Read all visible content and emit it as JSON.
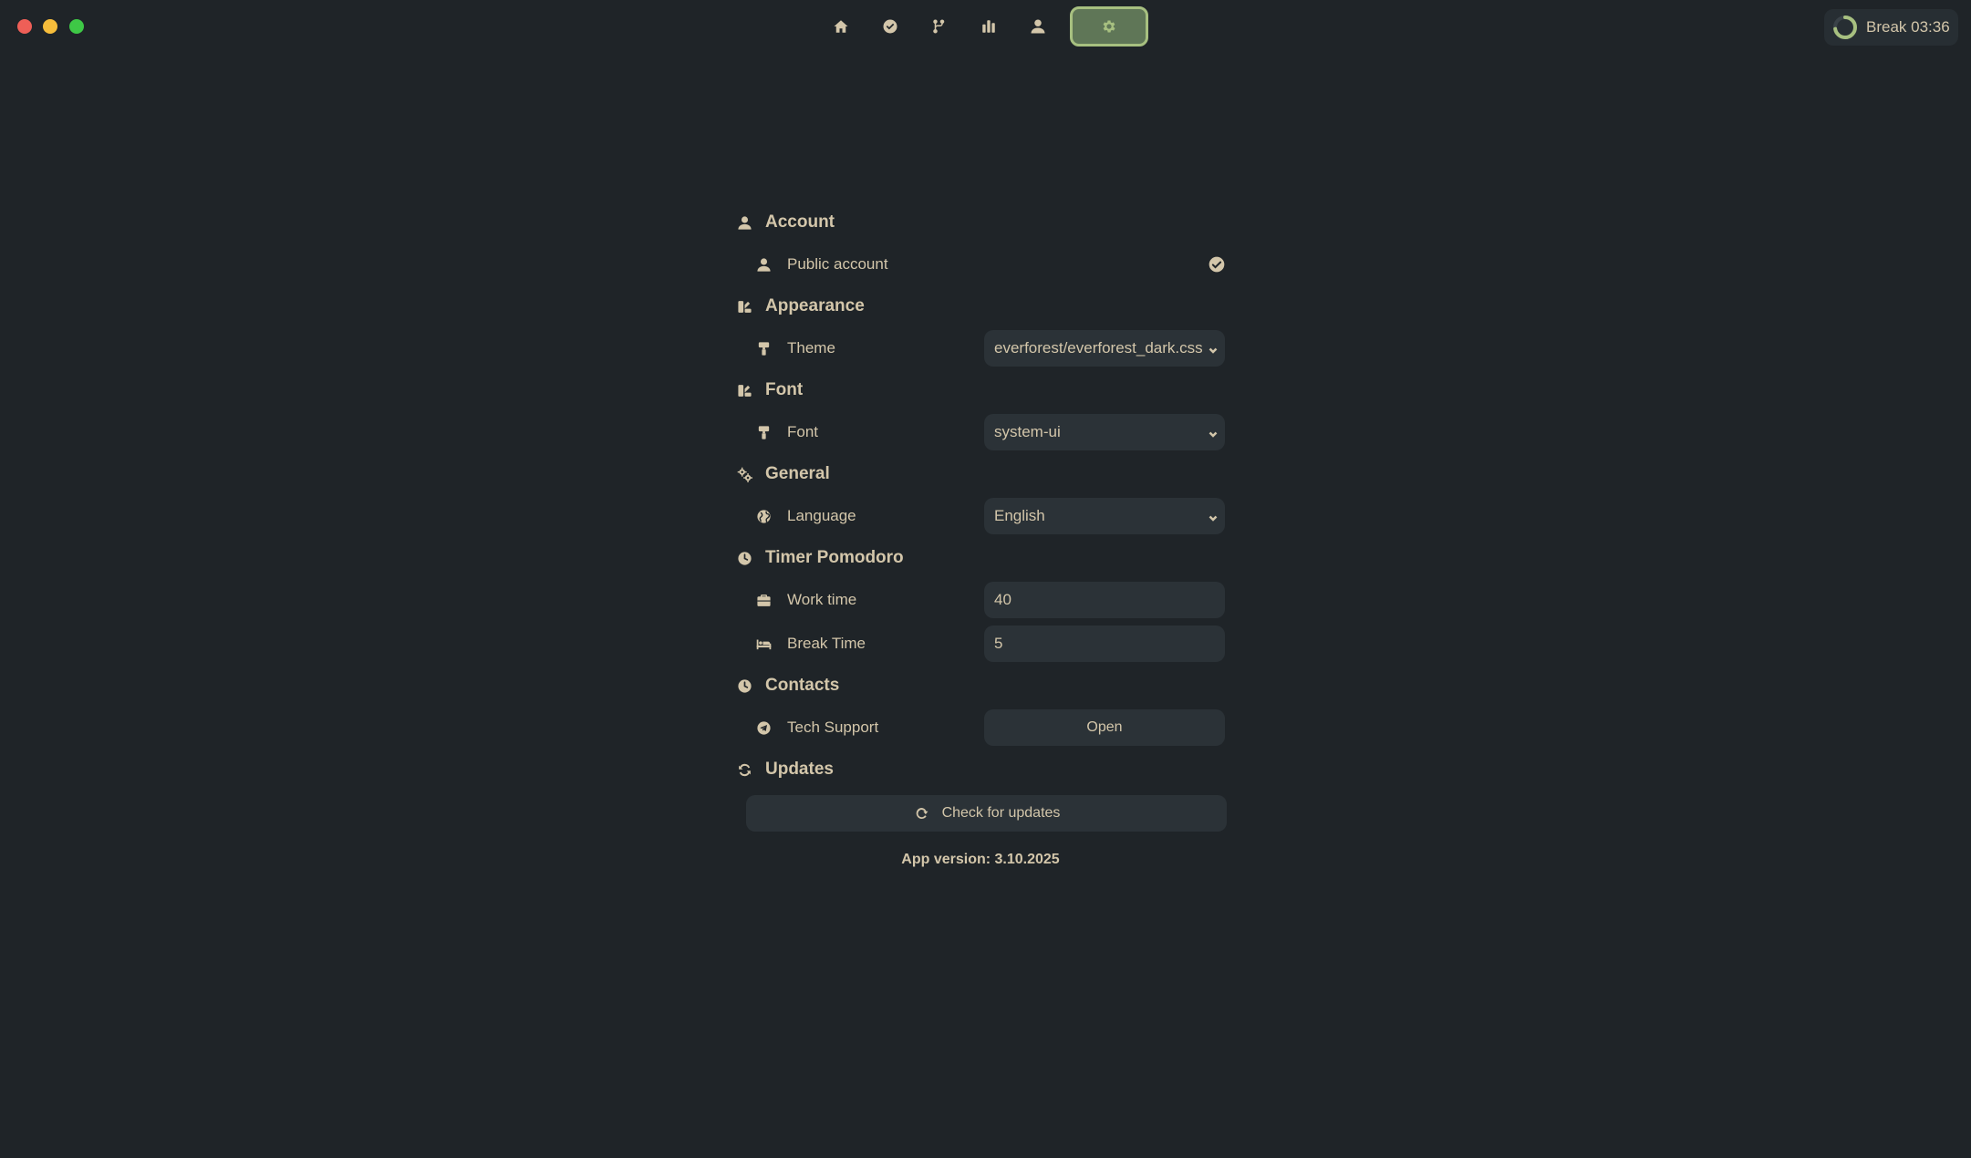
{
  "window": {
    "traffic_lights": [
      "close",
      "minimize",
      "zoom"
    ]
  },
  "nav": {
    "items": [
      {
        "icon": "home-icon"
      },
      {
        "icon": "check-circle-icon"
      },
      {
        "icon": "branch-icon"
      },
      {
        "icon": "bar-chart-icon"
      },
      {
        "icon": "user-icon"
      },
      {
        "icon": "gear-icon",
        "active": true
      }
    ]
  },
  "timer": {
    "label": "Break 03:36",
    "progress": 0.72
  },
  "settings": {
    "account": {
      "title": "Account",
      "public_account_label": "Public account",
      "public_account_checked": true
    },
    "appearance": {
      "title": "Appearance",
      "theme_label": "Theme",
      "theme_value": "everforest/everforest_dark.css"
    },
    "font": {
      "title": "Font",
      "font_label": "Font",
      "font_value": "system-ui"
    },
    "general": {
      "title": "General",
      "language_label": "Language",
      "language_value": "English"
    },
    "timer": {
      "title": "Timer Pomodoro",
      "work_time_label": "Work time",
      "work_time_value": "40",
      "break_time_label": "Break Time",
      "break_time_value": "5"
    },
    "contacts": {
      "title": "Contacts",
      "tech_support_label": "Tech Support",
      "open_button": "Open"
    },
    "updates": {
      "title": "Updates",
      "check_button": "Check for updates"
    },
    "app_version": "App version: 3.10.2025"
  },
  "colors": {
    "background": "#1f2428",
    "control": "#2b3237",
    "text": "#d3c6aa",
    "accent": "#a7c080",
    "accent_bg": "#5f7657"
  }
}
